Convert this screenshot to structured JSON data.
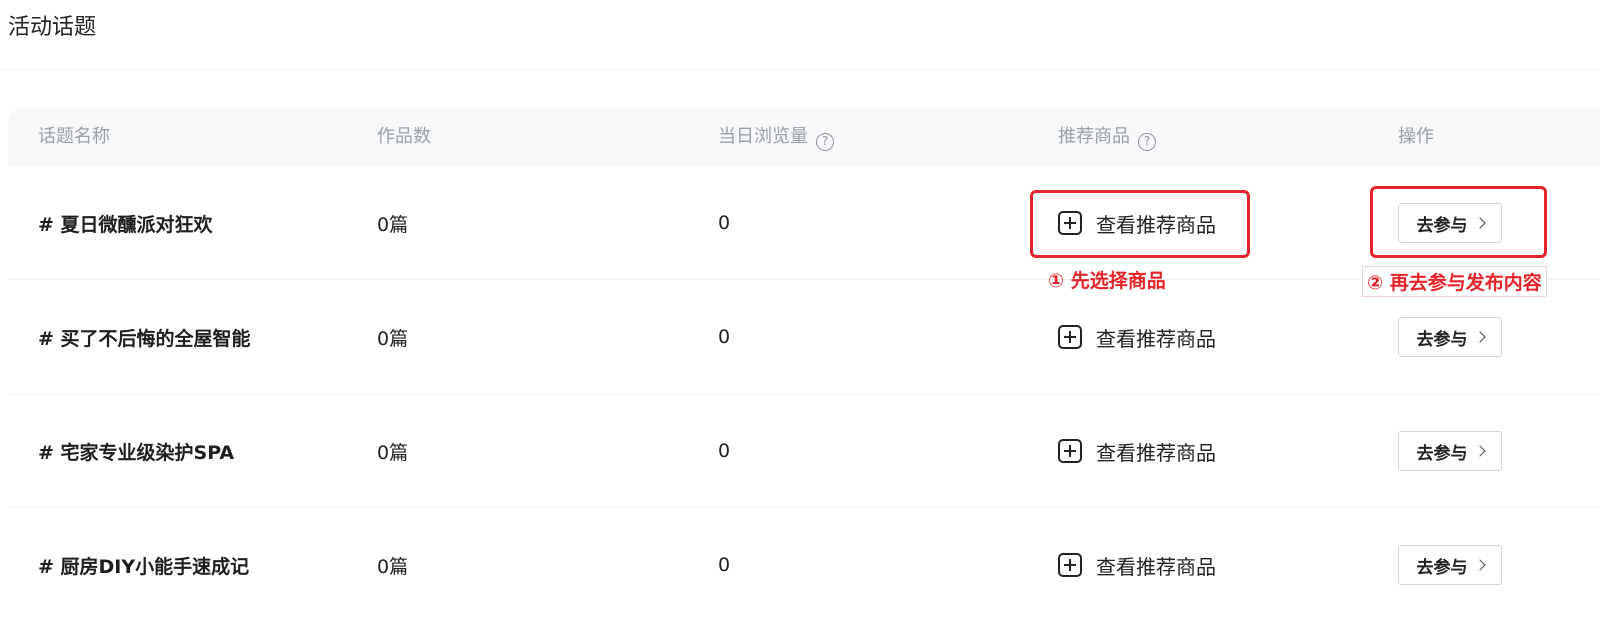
{
  "page": {
    "title": "活动话题"
  },
  "table": {
    "headers": {
      "topic_name": "话题名称",
      "works_count": "作品数",
      "daily_views": "当日浏览量",
      "recommended_goods": "推荐商品",
      "action": "操作"
    },
    "help_glyph": "?",
    "rows": [
      {
        "topic": "# 夏日微醺派对狂欢",
        "works": "0篇",
        "views": "0",
        "goods_label": "查看推荐商品",
        "action_label": "去参与"
      },
      {
        "topic": "# 买了不后悔的全屋智能",
        "works": "0篇",
        "views": "0",
        "goods_label": "查看推荐商品",
        "action_label": "去参与"
      },
      {
        "topic": "# 宅家专业级染护SPA",
        "works": "0篇",
        "views": "0",
        "goods_label": "查看推荐商品",
        "action_label": "去参与"
      },
      {
        "topic": "# 厨房DIY小能手速成记",
        "works": "0篇",
        "views": "0",
        "goods_label": "查看推荐商品",
        "action_label": "去参与"
      }
    ]
  },
  "annotations": {
    "step1": "① 先选择商品",
    "step2": "② 再去参与发布内容"
  },
  "colors": {
    "highlight": "#e8232a",
    "header_bg": "#f7f8fa",
    "header_text": "#9ba0a7"
  },
  "icons": [
    "help-icon",
    "plus-icon",
    "chevron-right-icon"
  ]
}
